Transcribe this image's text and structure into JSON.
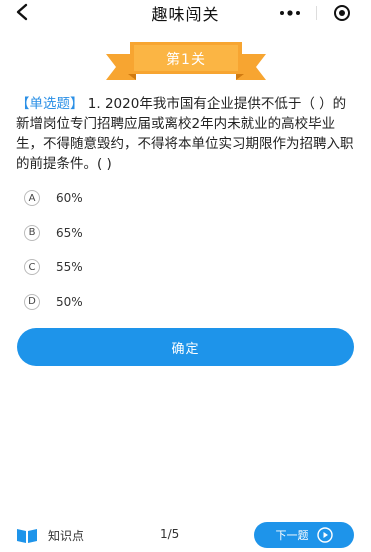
{
  "nav": {
    "title": "趣味闯关",
    "more_dots": "•••"
  },
  "level": {
    "label": "第1关",
    "colors": {
      "ribbon": "#f7a531",
      "ribbon_dark": "#e08a16"
    }
  },
  "question": {
    "type_tag": "【单选题】",
    "text": " 1. 2020年我市国有企业提供不低于（ ）的新增岗位专门招聘应届或离校2年内未就业的高校毕业生，不得随意毁约，不得将本单位实习期限作为招聘入职的前提条件。( )"
  },
  "options": [
    {
      "letter": "A",
      "text": "60%"
    },
    {
      "letter": "B",
      "text": "65%"
    },
    {
      "letter": "C",
      "text": "55%"
    },
    {
      "letter": "D",
      "text": "50%"
    }
  ],
  "confirm_label": "确定",
  "bottom": {
    "knowledge_label": "知识点",
    "page_indicator": "1/5",
    "next_label": "下一题"
  },
  "colors": {
    "accent": "#1e94ea",
    "type_tag": "#2a8fe6"
  }
}
